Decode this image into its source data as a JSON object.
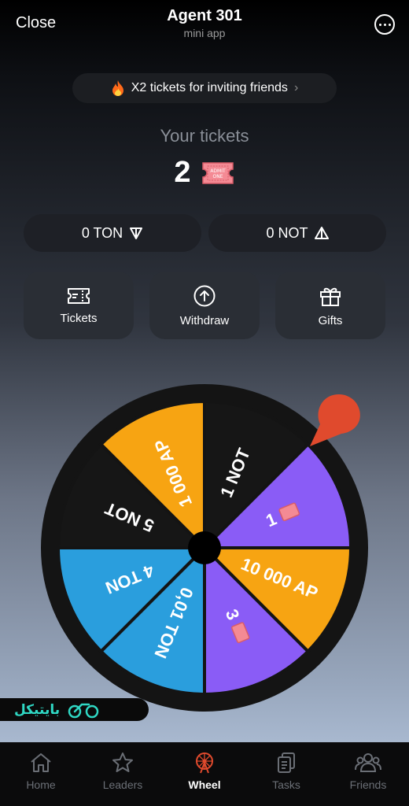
{
  "header": {
    "close_label": "Close",
    "title": "Agent 301",
    "subtitle": "mini app"
  },
  "promo": {
    "text": "X2 tickets for inviting friends"
  },
  "tickets": {
    "label": "Your tickets",
    "count": "2",
    "ticket_badge_line1": "ADMIT",
    "ticket_badge_line2": "ONE"
  },
  "balances": {
    "ton": "0 TON",
    "not": "0 NOT"
  },
  "actions": {
    "tickets": "Tickets",
    "withdraw": "Withdraw",
    "gifts": "Gifts"
  },
  "wheel": {
    "segments": [
      {
        "label": "1 NOT",
        "color": "#161616"
      },
      {
        "label": "1",
        "color": "#8a5cf6",
        "ticket": true
      },
      {
        "label": "10 000 AP",
        "color": "#f7a412"
      },
      {
        "label": "3",
        "color": "#8a5cf6",
        "ticket": true
      },
      {
        "label": "0,01 TON",
        "color": "#2a9edd"
      },
      {
        "label": "4 TON",
        "color": "#2a9edd"
      },
      {
        "label": "5 NOT",
        "color": "#161616"
      },
      {
        "label": "1 000 AP",
        "color": "#f7a412"
      }
    ],
    "pointer_color": "#e04a2d"
  },
  "watermark": {
    "text": "بایتیکل"
  },
  "nav": {
    "home": "Home",
    "leaders": "Leaders",
    "wheel": "Wheel",
    "tasks": "Tasks",
    "friends": "Friends"
  }
}
